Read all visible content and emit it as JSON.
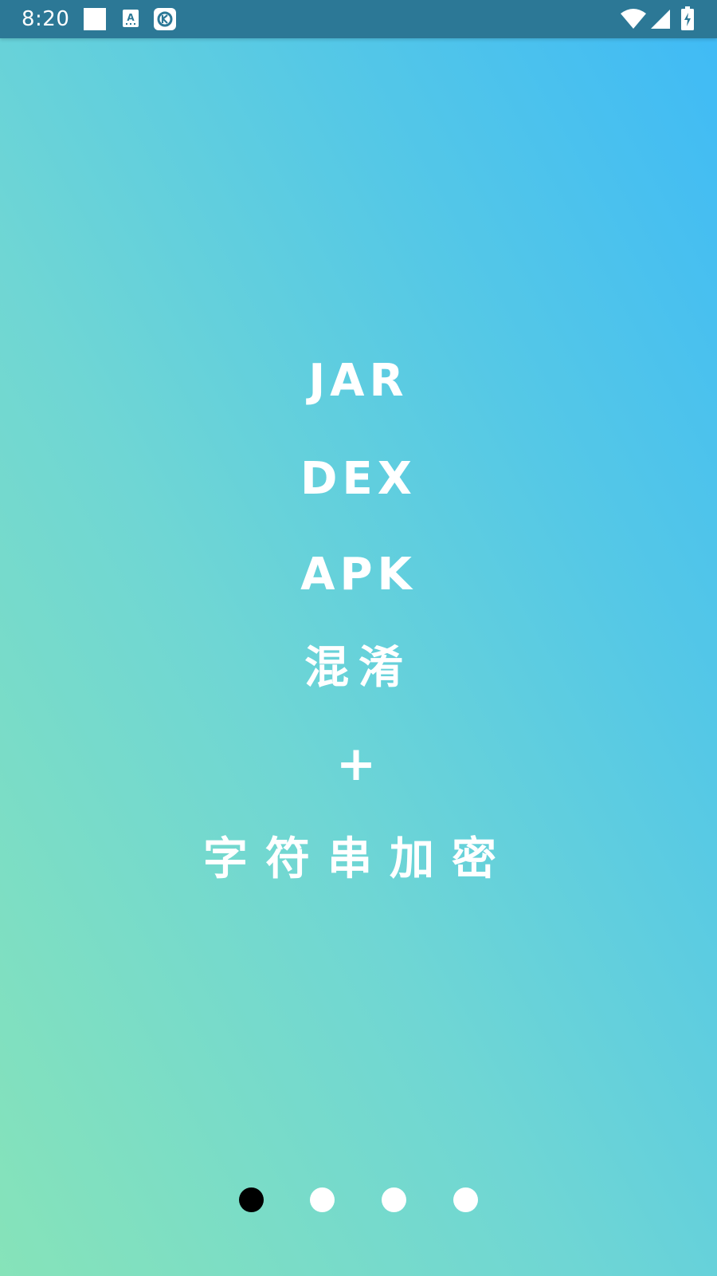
{
  "status_bar": {
    "time": "8:20",
    "icons": [
      "notification-square-icon",
      "keyboard-a-icon",
      "k-app-icon",
      "wifi-icon",
      "signal-icon",
      "battery-charging-icon"
    ]
  },
  "content": {
    "lines": [
      "JAR",
      "DEX",
      "APK",
      "混淆",
      "+",
      "字符串加密"
    ]
  },
  "pager": {
    "count": 4,
    "active_index": 0,
    "active_color": "#000000",
    "inactive_color": "#ffffff"
  },
  "colors": {
    "background_gradient": [
      "#86e3b9",
      "#6fd6d4",
      "#55c8e6",
      "#3fbaf6"
    ],
    "status_bar": "#2c7896",
    "text": "#ffffff"
  }
}
